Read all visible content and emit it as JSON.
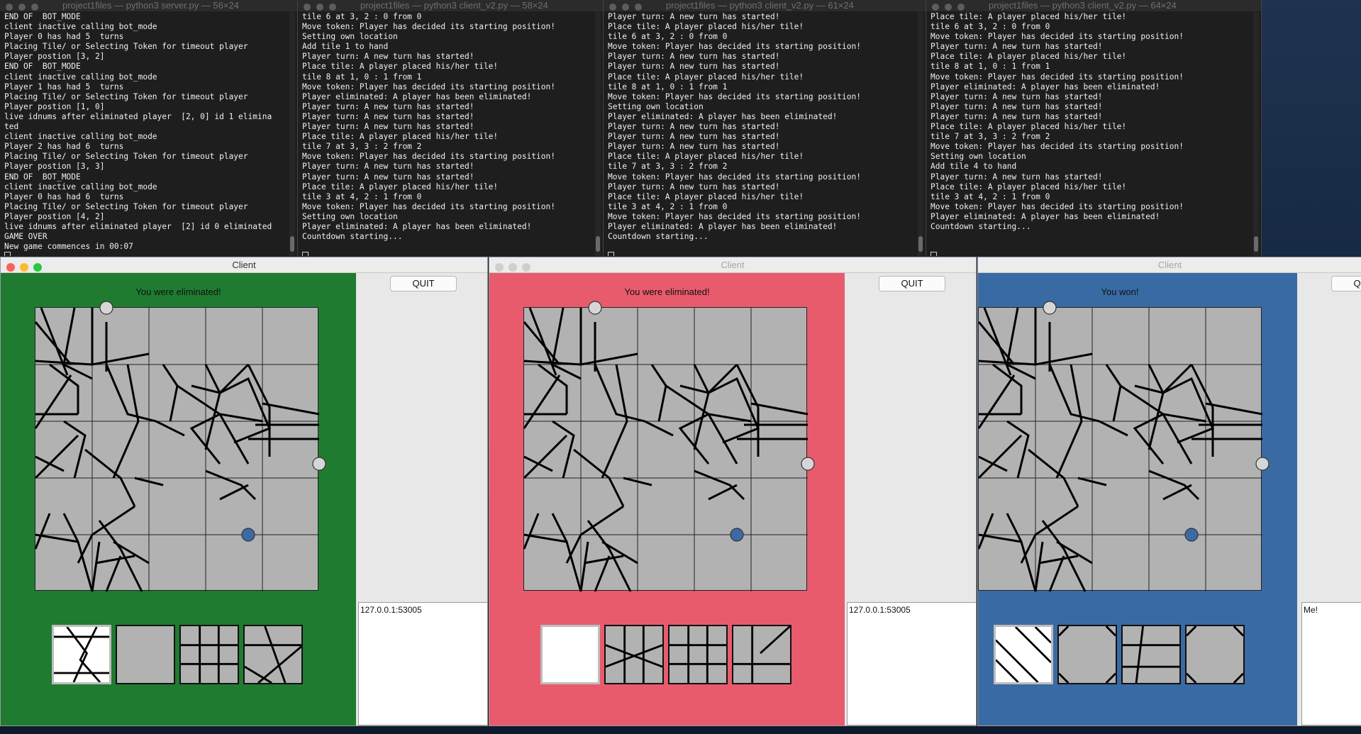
{
  "terminals": [
    {
      "title": "project1files — python3 server.py — 56×24",
      "lines": [
        "END OF  BOT_MODE",
        "client inactive calling bot_mode",
        "Player 0 has had 5  turns",
        "Placing Tile/ or Selecting Token for timeout player",
        "Player postion [3, 2]",
        "END OF  BOT_MODE",
        "client inactive calling bot_mode",
        "Player 1 has had 5  turns",
        "Placing Tile/ or Selecting Token for timeout player",
        "Player postion [1, 0]",
        "live idnums after eliminated player  [2, 0] id 1 elimina",
        "ted",
        "client inactive calling bot_mode",
        "Player 2 has had 6  turns",
        "Placing Tile/ or Selecting Token for timeout player",
        "Player postion [3, 3]",
        "END OF  BOT_MODE",
        "client inactive calling bot_mode",
        "Player 0 has had 6  turns",
        "Placing Tile/ or Selecting Token for timeout player",
        "Player postion [4, 2]",
        "live idnums after eliminated player  [2] id 0 eliminated",
        "GAME OVER",
        "New game commences in 00:07"
      ]
    },
    {
      "title": "project1files — python3 client_v2.py — 58×24",
      "lines": [
        "tile 6 at 3, 2 : 0 from 0",
        "Move token: Player has decided its starting position!",
        "Setting own location",
        "Add tile 1 to hand",
        "Player turn: A new turn has started!",
        "Place tile: A player placed his/her tile!",
        "tile 8 at 1, 0 : 1 from 1",
        "Move token: Player has decided its starting position!",
        "Player eliminated: A player has been eliminated!",
        "Player turn: A new turn has started!",
        "Player turn: A new turn has started!",
        "Player turn: A new turn has started!",
        "Place tile: A player placed his/her tile!",
        "tile 7 at 3, 3 : 2 from 2",
        "Move token: Player has decided its starting position!",
        "Player turn: A new turn has started!",
        "Player turn: A new turn has started!",
        "Place tile: A player placed his/her tile!",
        "tile 3 at 4, 2 : 1 from 0",
        "Move token: Player has decided its starting position!",
        "Setting own location",
        "Player eliminated: A player has been eliminated!",
        "Countdown starting...",
        ""
      ]
    },
    {
      "title": "project1files — python3 client_v2.py — 61×24",
      "lines": [
        "Player turn: A new turn has started!",
        "Place tile: A player placed his/her tile!",
        "tile 6 at 3, 2 : 0 from 0",
        "Move token: Player has decided its starting position!",
        "Player turn: A new turn has started!",
        "Player turn: A new turn has started!",
        "Place tile: A player placed his/her tile!",
        "tile 8 at 1, 0 : 1 from 1",
        "Move token: Player has decided its starting position!",
        "Setting own location",
        "Player eliminated: A player has been eliminated!",
        "Player turn: A new turn has started!",
        "Player turn: A new turn has started!",
        "Player turn: A new turn has started!",
        "Place tile: A player placed his/her tile!",
        "tile 7 at 3, 3 : 2 from 2",
        "Move token: Player has decided its starting position!",
        "Player turn: A new turn has started!",
        "Place tile: A player placed his/her tile!",
        "tile 3 at 4, 2 : 1 from 0",
        "Move token: Player has decided its starting position!",
        "Player eliminated: A player has been eliminated!",
        "Countdown starting...",
        ""
      ]
    },
    {
      "title": "project1files — python3 client_v2.py — 64×24",
      "lines": [
        "Place tile: A player placed his/her tile!",
        "tile 6 at 3, 2 : 0 from 0",
        "Move token: Player has decided its starting position!",
        "Player turn: A new turn has started!",
        "Place tile: A player placed his/her tile!",
        "tile 8 at 1, 0 : 1 from 1",
        "Move token: Player has decided its starting position!",
        "Player eliminated: A player has been eliminated!",
        "Player turn: A new turn has started!",
        "Player turn: A new turn has started!",
        "Player turn: A new turn has started!",
        "Place tile: A player placed his/her tile!",
        "tile 7 at 3, 3 : 2 from 2",
        "Move token: Player has decided its starting position!",
        "Setting own location",
        "Add tile 4 to hand",
        "Player turn: A new turn has started!",
        "Place tile: A player placed his/her tile!",
        "tile 3 at 4, 2 : 1 from 0",
        "Move token: Player has decided its starting position!",
        "Player eliminated: A player has been eliminated!",
        "Countdown starting...",
        "",
        ""
      ]
    }
  ],
  "clients": [
    {
      "title": "Client",
      "status": "You were eliminated!",
      "background": "#1f7b30",
      "quit_label": "QUIT",
      "log_text": "127.0.0.1:53005",
      "hand_selected_index": 0
    },
    {
      "title": "Client",
      "status": "You were eliminated!",
      "background": "#e85b6d",
      "quit_label": "QUIT",
      "log_text": "127.0.0.1:53005",
      "hand_selected_index": 0
    },
    {
      "title": "Client",
      "status": "You won!",
      "background": "#3a6aa3",
      "quit_label": "QUIT",
      "log_text": "Me!",
      "hand_selected_index": 0
    }
  ],
  "colors": {
    "terminal_bg": "#1e1e1e",
    "terminal_text": "#f0f0f0",
    "tile_gray": "#b2b2b2",
    "token_blue": "#3d6aa5",
    "token_white": "#d6d6d6",
    "window_close": "#fc5f57",
    "window_min": "#fdbc2e",
    "window_max": "#28c840"
  },
  "icons": {
    "terminal_controls": "window-dots",
    "token_player": "blue-circle-token",
    "token_eliminated": "gray-circle-token"
  }
}
